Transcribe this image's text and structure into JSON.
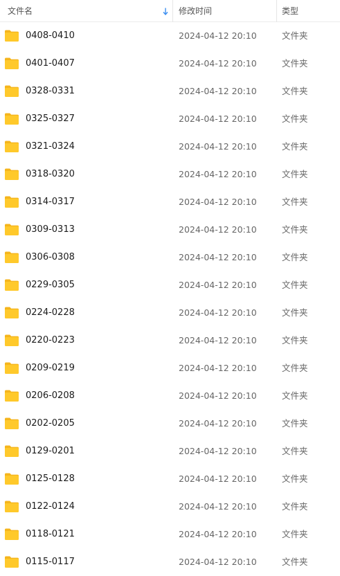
{
  "header": {
    "name_label": "文件名",
    "date_label": "修改时间",
    "type_label": "类型",
    "sort_icon": "arrow-down-icon",
    "sort_color": "#3b8ef0"
  },
  "folder_icon": {
    "name": "folder-icon",
    "color": "#ffc92b",
    "tab_color": "#f5b51c"
  },
  "files": [
    {
      "name": "0408-0410",
      "modified": "2024-04-12 20:10",
      "type": "文件夹"
    },
    {
      "name": "0401-0407",
      "modified": "2024-04-12 20:10",
      "type": "文件夹"
    },
    {
      "name": "0328-0331",
      "modified": "2024-04-12 20:10",
      "type": "文件夹"
    },
    {
      "name": "0325-0327",
      "modified": "2024-04-12 20:10",
      "type": "文件夹"
    },
    {
      "name": "0321-0324",
      "modified": "2024-04-12 20:10",
      "type": "文件夹"
    },
    {
      "name": "0318-0320",
      "modified": "2024-04-12 20:10",
      "type": "文件夹"
    },
    {
      "name": "0314-0317",
      "modified": "2024-04-12 20:10",
      "type": "文件夹"
    },
    {
      "name": "0309-0313",
      "modified": "2024-04-12 20:10",
      "type": "文件夹"
    },
    {
      "name": "0306-0308",
      "modified": "2024-04-12 20:10",
      "type": "文件夹"
    },
    {
      "name": "0229-0305",
      "modified": "2024-04-12 20:10",
      "type": "文件夹"
    },
    {
      "name": "0224-0228",
      "modified": "2024-04-12 20:10",
      "type": "文件夹"
    },
    {
      "name": "0220-0223",
      "modified": "2024-04-12 20:10",
      "type": "文件夹"
    },
    {
      "name": "0209-0219",
      "modified": "2024-04-12 20:10",
      "type": "文件夹"
    },
    {
      "name": "0206-0208",
      "modified": "2024-04-12 20:10",
      "type": "文件夹"
    },
    {
      "name": "0202-0205",
      "modified": "2024-04-12 20:10",
      "type": "文件夹"
    },
    {
      "name": "0129-0201",
      "modified": "2024-04-12 20:10",
      "type": "文件夹"
    },
    {
      "name": "0125-0128",
      "modified": "2024-04-12 20:10",
      "type": "文件夹"
    },
    {
      "name": "0122-0124",
      "modified": "2024-04-12 20:10",
      "type": "文件夹"
    },
    {
      "name": "0118-0121",
      "modified": "2024-04-12 20:10",
      "type": "文件夹"
    },
    {
      "name": "0115-0117",
      "modified": "2024-04-12 20:10",
      "type": "文件夹"
    }
  ]
}
